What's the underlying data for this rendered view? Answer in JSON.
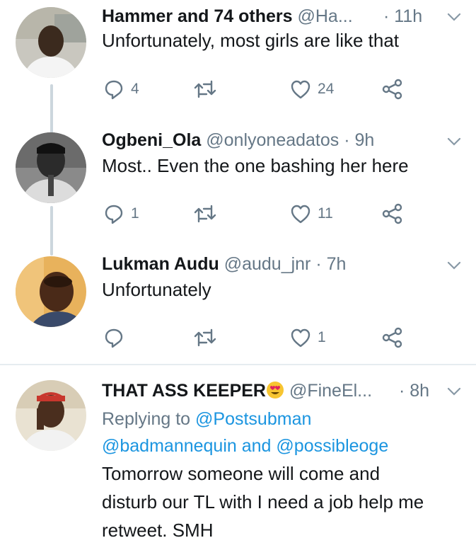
{
  "tweets": [
    {
      "name": "Hammer and 74 others",
      "handle": "@Ha...",
      "time": "· 11h",
      "text": "Unfortunately, most girls are like that",
      "reply_count": "4",
      "retweet_count": "",
      "like_count": "24"
    },
    {
      "name": "Ogbeni_Ola",
      "handle": "@onlyoneadatos",
      "time": "· 9h",
      "text": "Most.. Even the one bashing her here",
      "reply_count": "1",
      "retweet_count": "",
      "like_count": "11"
    },
    {
      "name": "Lukman Audu",
      "handle": "@audu_jnr",
      "time": "· 7h",
      "text": "Unfortunately",
      "reply_count": "",
      "retweet_count": "",
      "like_count": "1"
    },
    {
      "name": "THAT ASS KEEPER",
      "name_emoji": "smiling-face-with-heart-eyes",
      "handle": "@FineEl...",
      "time": "· 8h",
      "replying_prefix": "Replying to",
      "replying_user1": "@Postsubman",
      "replying_user2": "@badmannequin",
      "replying_and": "and",
      "replying_user3": "@possibleoge",
      "text_line1": "Tomorrow someone will come and",
      "text_line2": "disturb our TL with I need a job help me",
      "text_line3": "retweet. SMH"
    }
  ],
  "colors": {
    "link": "#1b95e0",
    "secondary_text": "#657786",
    "thread_line": "#ccd6dd"
  }
}
